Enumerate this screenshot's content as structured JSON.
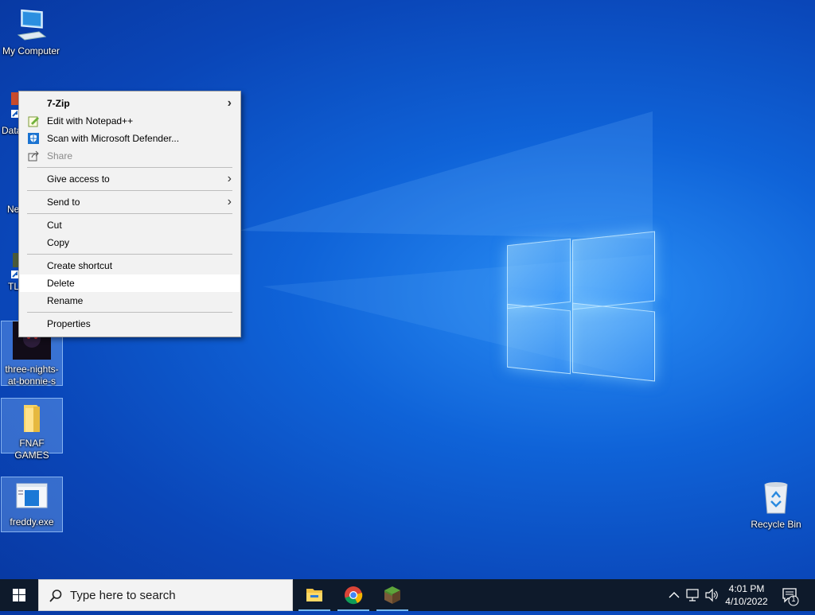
{
  "desktop": {
    "icons": [
      {
        "label": "My Computer"
      },
      {
        "label": "Data"
      },
      {
        "label": "Ne"
      },
      {
        "label": "TL"
      },
      {
        "label": "three-nights-at-bonnie-s"
      },
      {
        "label": "FNAF GAMES"
      },
      {
        "label": "freddy.exe"
      },
      {
        "label": "Recycle Bin"
      }
    ]
  },
  "context_menu": {
    "items": [
      {
        "label": "7-Zip"
      },
      {
        "label": "Edit with Notepad++"
      },
      {
        "label": "Scan with Microsoft Defender..."
      },
      {
        "label": "Share"
      },
      {
        "label": "Give access to"
      },
      {
        "label": "Send to"
      },
      {
        "label": "Cut"
      },
      {
        "label": "Copy"
      },
      {
        "label": "Create shortcut"
      },
      {
        "label": "Delete"
      },
      {
        "label": "Rename"
      },
      {
        "label": "Properties"
      }
    ],
    "highlighted": "Delete"
  },
  "taskbar": {
    "search_placeholder": "Type here to search",
    "clock_time": "4:01 PM",
    "clock_date": "4/10/2022",
    "notification_count": "1",
    "pinned": [
      "file-explorer",
      "chrome",
      "minecraft"
    ]
  },
  "colors": {
    "accent": "#0f63d8",
    "taskbar": "#0e1a2b",
    "menu_bg": "#f2f2f2"
  }
}
